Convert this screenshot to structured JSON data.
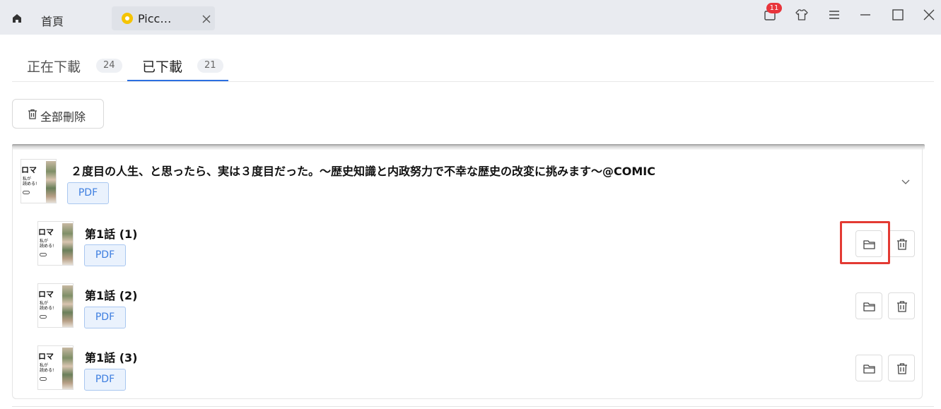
{
  "titlebar": {
    "home_label": "首頁",
    "tab_title": "Picc…",
    "notification_count": "11",
    "icons": [
      "home-icon",
      "app-logo-icon",
      "close-icon",
      "notification-icon",
      "skin-icon",
      "menu-icon",
      "minimize-icon",
      "maximize-icon",
      "window-close-icon"
    ]
  },
  "download_tabs": [
    {
      "label": "正在下載",
      "count": "24",
      "active": false
    },
    {
      "label": "已下載",
      "count": "21",
      "active": true
    }
  ],
  "toolbar": {
    "delete_all_label": "全部刪除"
  },
  "series": {
    "title": "２度目の人生、と思ったら、実は３度目だった。～歴史知識と内政努力で不幸な歴史の改変に挑みます～@COMIC",
    "format": "PDF",
    "thumbnail": {
      "text_large": "ロマ",
      "text_small_1": "私が",
      "text_small_2": "読める!"
    },
    "episodes": [
      {
        "title": "第1話 (1)",
        "format": "PDF",
        "highlighted": true
      },
      {
        "title": "第1話 (2)",
        "format": "PDF",
        "highlighted": false
      },
      {
        "title": "第1話 (3)",
        "format": "PDF",
        "highlighted": false
      }
    ]
  },
  "colors": {
    "accent": "#2b6fe0",
    "badge": "#e8343b",
    "highlight": "#e33a33",
    "pdf_tag_text": "#3d7ee0"
  }
}
